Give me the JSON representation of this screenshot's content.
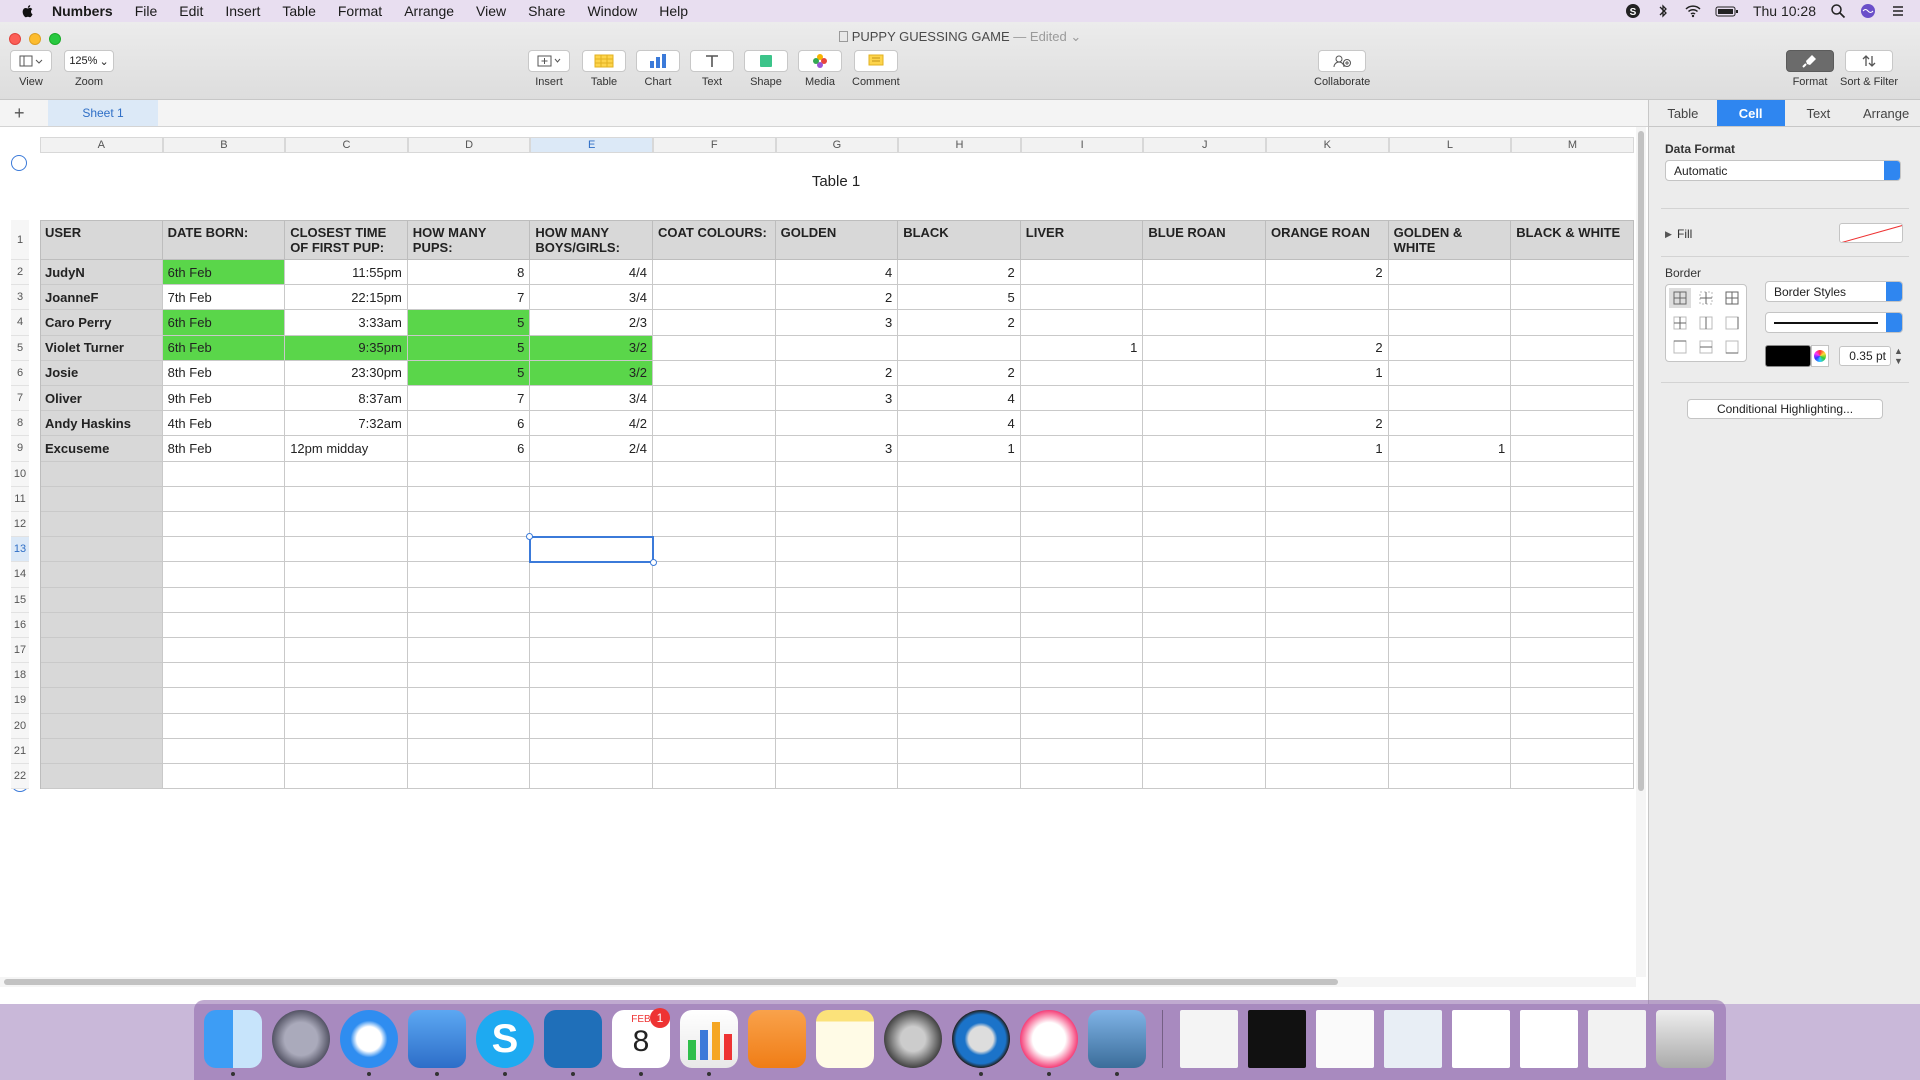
{
  "menubar": {
    "items": [
      "Numbers",
      "File",
      "Edit",
      "Insert",
      "Table",
      "Format",
      "Arrange",
      "View",
      "Share",
      "Window",
      "Help"
    ],
    "clock": "Thu 10:28"
  },
  "window": {
    "title": "PUPPY GUESSING GAME",
    "title_status": "— Edited"
  },
  "toolbar": {
    "view_label": "View",
    "zoom_value": "125%",
    "zoom_label": "Zoom",
    "insert_label": "Insert",
    "table_label": "Table",
    "chart_label": "Chart",
    "text_label": "Text",
    "shape_label": "Shape",
    "media_label": "Media",
    "comment_label": "Comment",
    "collaborate_label": "Collaborate",
    "format_label": "Format",
    "sort_label": "Sort & Filter"
  },
  "sheet": {
    "tab_name": "Sheet 1",
    "table_title": "Table 1",
    "columns": [
      "A",
      "B",
      "C",
      "D",
      "E",
      "F",
      "G",
      "H",
      "I",
      "J",
      "K",
      "L",
      "M"
    ],
    "selected_column": "E",
    "selected_row": 13,
    "headers": [
      "USER",
      "DATE BORN:",
      "CLOSEST TIME OF FIRST PUP:",
      "HOW MANY PUPS:",
      "HOW MANY BOYS/GIRLS:",
      "COAT COLOURS:",
      "GOLDEN",
      "BLACK",
      "LIVER",
      "BLUE ROAN",
      "ORANGE ROAN",
      "GOLDEN & WHITE",
      "BLACK & WHITE"
    ],
    "rows": [
      [
        "JudyN",
        "6th Feb",
        "11:55pm",
        "8",
        "4/4",
        "",
        "4",
        "2",
        "",
        "",
        "2",
        "",
        ""
      ],
      [
        "JoanneF",
        "7th Feb",
        "22:15pm",
        "7",
        "3/4",
        "",
        "2",
        "5",
        "",
        "",
        "",
        "",
        ""
      ],
      [
        "Caro Perry",
        "6th Feb",
        "3:33am",
        "5",
        "2/3",
        "",
        "3",
        "2",
        "",
        "",
        "",
        "",
        ""
      ],
      [
        "Violet Turner",
        "6th Feb",
        "9:35pm",
        "5",
        "3/2",
        "",
        "",
        "",
        "1",
        "",
        "2",
        "",
        ""
      ],
      [
        "Josie",
        "8th Feb",
        "23:30pm",
        "5",
        "3/2",
        "",
        "2",
        "2",
        "",
        "",
        "1",
        "",
        ""
      ],
      [
        "Oliver",
        "9th Feb",
        "8:37am",
        "7",
        "3/4",
        "",
        "3",
        "4",
        "",
        "",
        "",
        "",
        ""
      ],
      [
        "Andy Haskins",
        "4th Feb",
        "7:32am",
        "6",
        "4/2",
        "",
        "",
        "4",
        "",
        "",
        "2",
        "",
        ""
      ],
      [
        "Excuseme",
        "8th Feb",
        "12pm midday",
        "6",
        "2/4",
        "",
        "3",
        "1",
        "",
        "",
        "1",
        "1",
        ""
      ]
    ],
    "highlight_color": "#5ad64a",
    "highlighted_cells": [
      [
        0,
        1
      ],
      [
        2,
        1
      ],
      [
        2,
        3
      ],
      [
        3,
        1
      ],
      [
        3,
        2
      ],
      [
        3,
        3
      ],
      [
        3,
        4
      ],
      [
        4,
        3
      ],
      [
        4,
        4
      ]
    ],
    "total_rows": 22
  },
  "inspector": {
    "tabs": [
      "Table",
      "Cell",
      "Text",
      "Arrange"
    ],
    "active_tab": "Cell",
    "data_format_label": "Data Format",
    "data_format_value": "Automatic",
    "fill_label": "Fill",
    "border_label": "Border",
    "border_styles": "Border Styles",
    "border_width": "0.35 pt",
    "conditional_button": "Conditional Highlighting..."
  },
  "dock": {
    "calendar_month": "FEB",
    "calendar_day": "8",
    "calendar_badge": "1"
  }
}
